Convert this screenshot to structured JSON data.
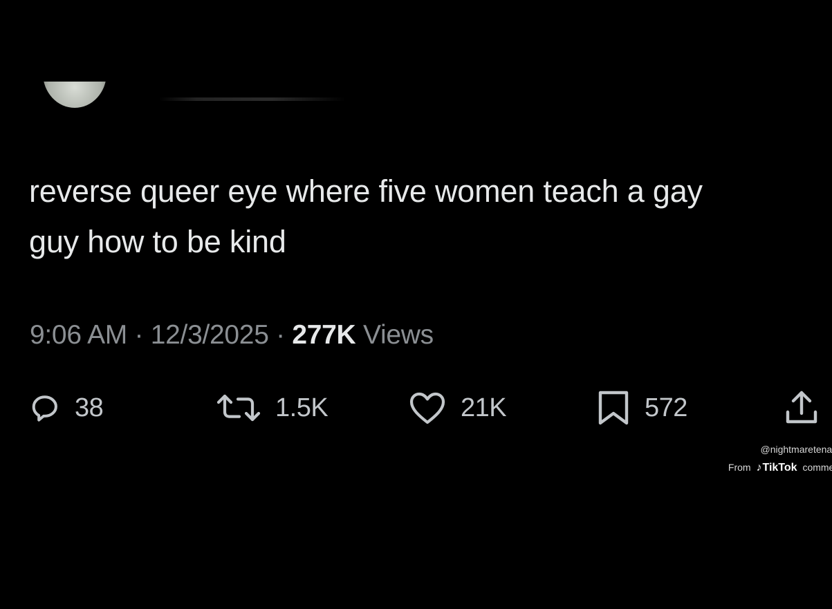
{
  "tweet": {
    "text_line_1": "reverse queer eye where five women teach a gay",
    "text_line_2": "guy how to be kind",
    "time": "9:06 AM",
    "separator": "·",
    "date": "12/3/2025",
    "views_count": "277K",
    "views_label": "Views"
  },
  "actions": {
    "reply": {
      "icon": "reply-icon",
      "count": "38"
    },
    "repost": {
      "icon": "repost-icon",
      "count": "1.5K"
    },
    "like": {
      "icon": "heart-icon",
      "count": "21K"
    },
    "bookmark": {
      "icon": "bookmark-icon",
      "count": "572"
    },
    "share": {
      "icon": "share-icon"
    }
  },
  "watermark": {
    "handle": "@nightmaretenan",
    "from": "From",
    "brand": "TikTok",
    "suffix": "commer"
  },
  "colors": {
    "background": "#000000",
    "text": "#e7e9ea",
    "muted": "#8b8f93",
    "icon": "#c2c6ca"
  }
}
